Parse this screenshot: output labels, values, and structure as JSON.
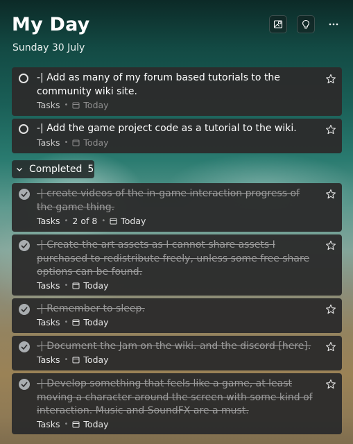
{
  "header": {
    "title": "My Day",
    "date": "Sunday 30 July"
  },
  "open_tasks": [
    {
      "title": "-| Add as many of my forum based tutorials to the community wiki site.",
      "list": "Tasks",
      "due": "Today"
    },
    {
      "title": "-| Add the game project code as a tutorial to the wiki.",
      "list": "Tasks",
      "due": "Today"
    }
  ],
  "completed": {
    "label": "Completed",
    "count": "5",
    "tasks": [
      {
        "title": "-| create videos of the in-game interaction progress of the game thing.",
        "list": "Tasks",
        "steps": "2 of 8",
        "due": "Today"
      },
      {
        "title": "-| Create the art assets as I cannot share assets I purchased to redistribute freely, unless some free share options can be found.",
        "list": "Tasks",
        "due": "Today"
      },
      {
        "title": "-| Remember to sleep.",
        "list": "Tasks",
        "due": "Today"
      },
      {
        "title": "-| Document the Jam on the wiki. and the discord [here].",
        "list": "Tasks",
        "due": "Today"
      },
      {
        "title": "-| Develop something that feels like a game, at least moving a character around the screen with some kind of interaction. Music and SoundFX are a must.",
        "list": "Tasks",
        "due": "Today"
      }
    ]
  },
  "icons": {
    "background": "image-icon",
    "suggestions": "lightbulb-icon",
    "more": "more-options-icon",
    "star": "star-outline-icon",
    "calendar": "calendar-icon",
    "chevron": "chevron-down-icon",
    "check": "checkmark-icon"
  },
  "colors": {
    "card": "#2c2c2c",
    "completed_check": "#a9adb0",
    "muted_text": "#9b9b9b"
  }
}
